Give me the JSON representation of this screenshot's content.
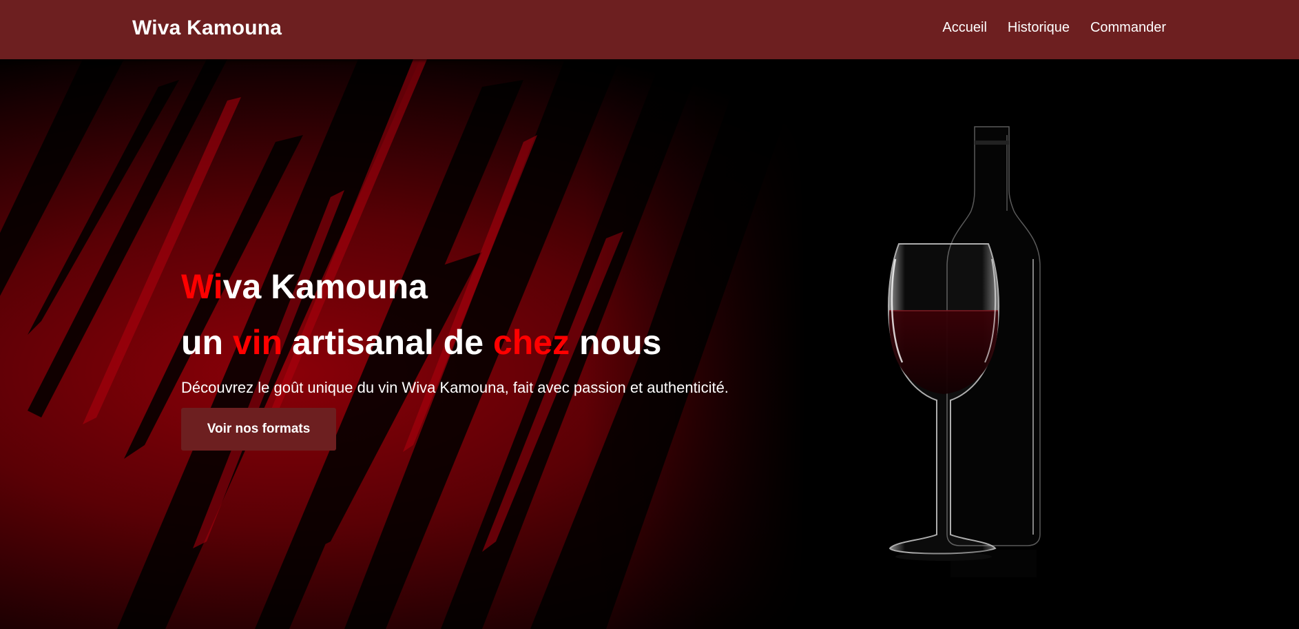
{
  "header": {
    "brand": "Wiva Kamouna",
    "nav": [
      {
        "label": "Accueil"
      },
      {
        "label": "Historique"
      },
      {
        "label": "Commander"
      }
    ]
  },
  "hero": {
    "title_line1_accent": "Wi",
    "title_line1_rest": "va Kamouna",
    "title_line2": {
      "w1": "un ",
      "w2": "vin",
      "w3": " artisanal de ",
      "w4": "chez",
      "w5": " nous"
    },
    "subtitle": "Découvrez le goût unique du vin Wiva Kamouna, fait avec passion et authenticité.",
    "cta_label": "Voir nos formats"
  },
  "colors": {
    "navbar": "#6d1f20",
    "accent": "#ff0000",
    "button": "#6d1f20"
  },
  "images": {
    "background": "red-brush-strokes",
    "product": "wine-bottle-and-glass"
  }
}
